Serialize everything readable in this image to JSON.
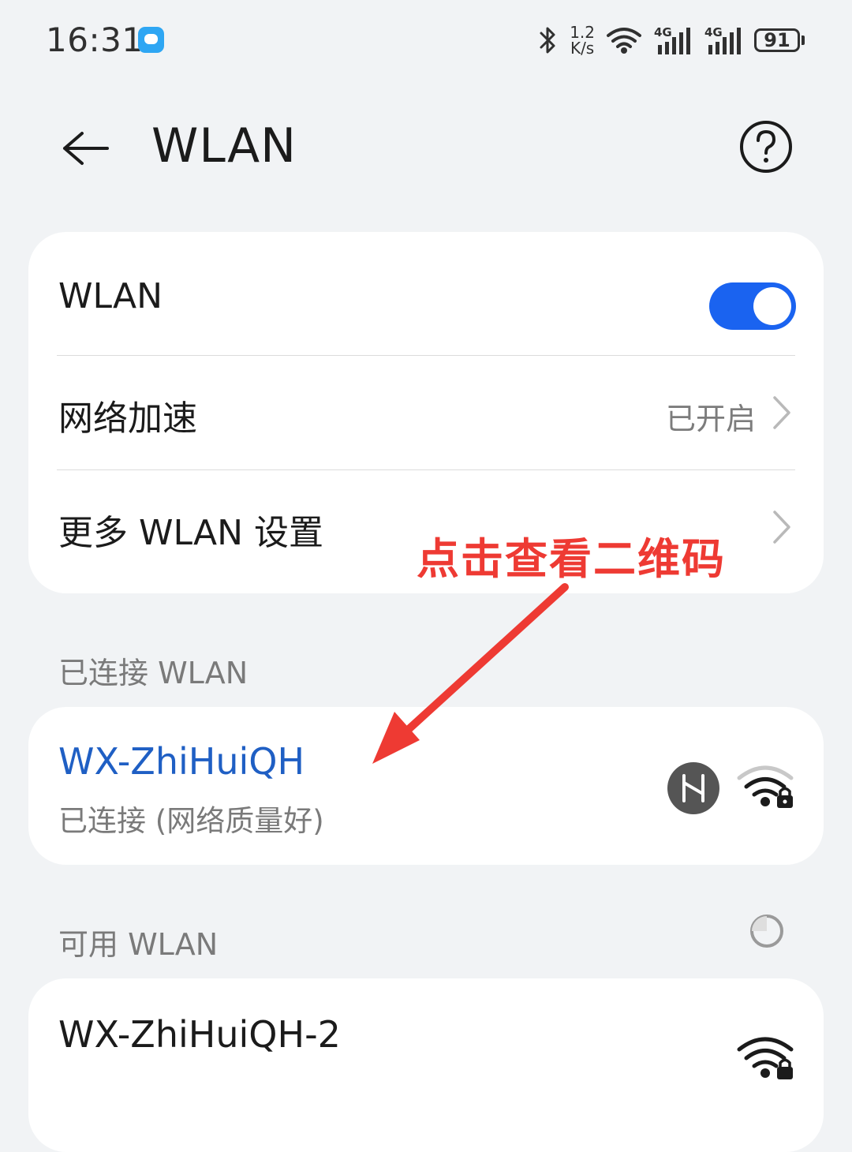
{
  "status_bar": {
    "time": "16:31",
    "net_speed_value": "1.2",
    "net_speed_unit": "K/s",
    "sim1_label": "4G",
    "sim2_label": "4G",
    "battery": "91"
  },
  "header": {
    "title": "WLAN"
  },
  "settings": {
    "wlan_label": "WLAN",
    "wlan_enabled": true,
    "acceleration_label": "网络加速",
    "acceleration_value": "已开启",
    "more_label": "更多 WLAN 设置"
  },
  "connected": {
    "section_title": "已连接 WLAN",
    "network_name": "WX-ZhiHuiQH",
    "network_status": "已连接 (网络质量好)"
  },
  "available": {
    "section_title": "可用 WLAN",
    "first_network_name": "WX-ZhiHuiQH-2"
  },
  "annotation": {
    "text": "点击查看二维码"
  },
  "colors": {
    "accent_blue": "#1a63f0",
    "connected_name": "#1f5fc4",
    "annotation_red": "#ee3a33",
    "background": "#f1f3f5"
  },
  "icons": [
    "message-icon",
    "bluetooth-icon",
    "wifi-status-icon",
    "signal-4g-icon",
    "battery-icon",
    "back-arrow-icon",
    "help-icon",
    "chevron-right-icon",
    "harmony-share-icon",
    "wifi-lock-icon",
    "scan-icon"
  ]
}
